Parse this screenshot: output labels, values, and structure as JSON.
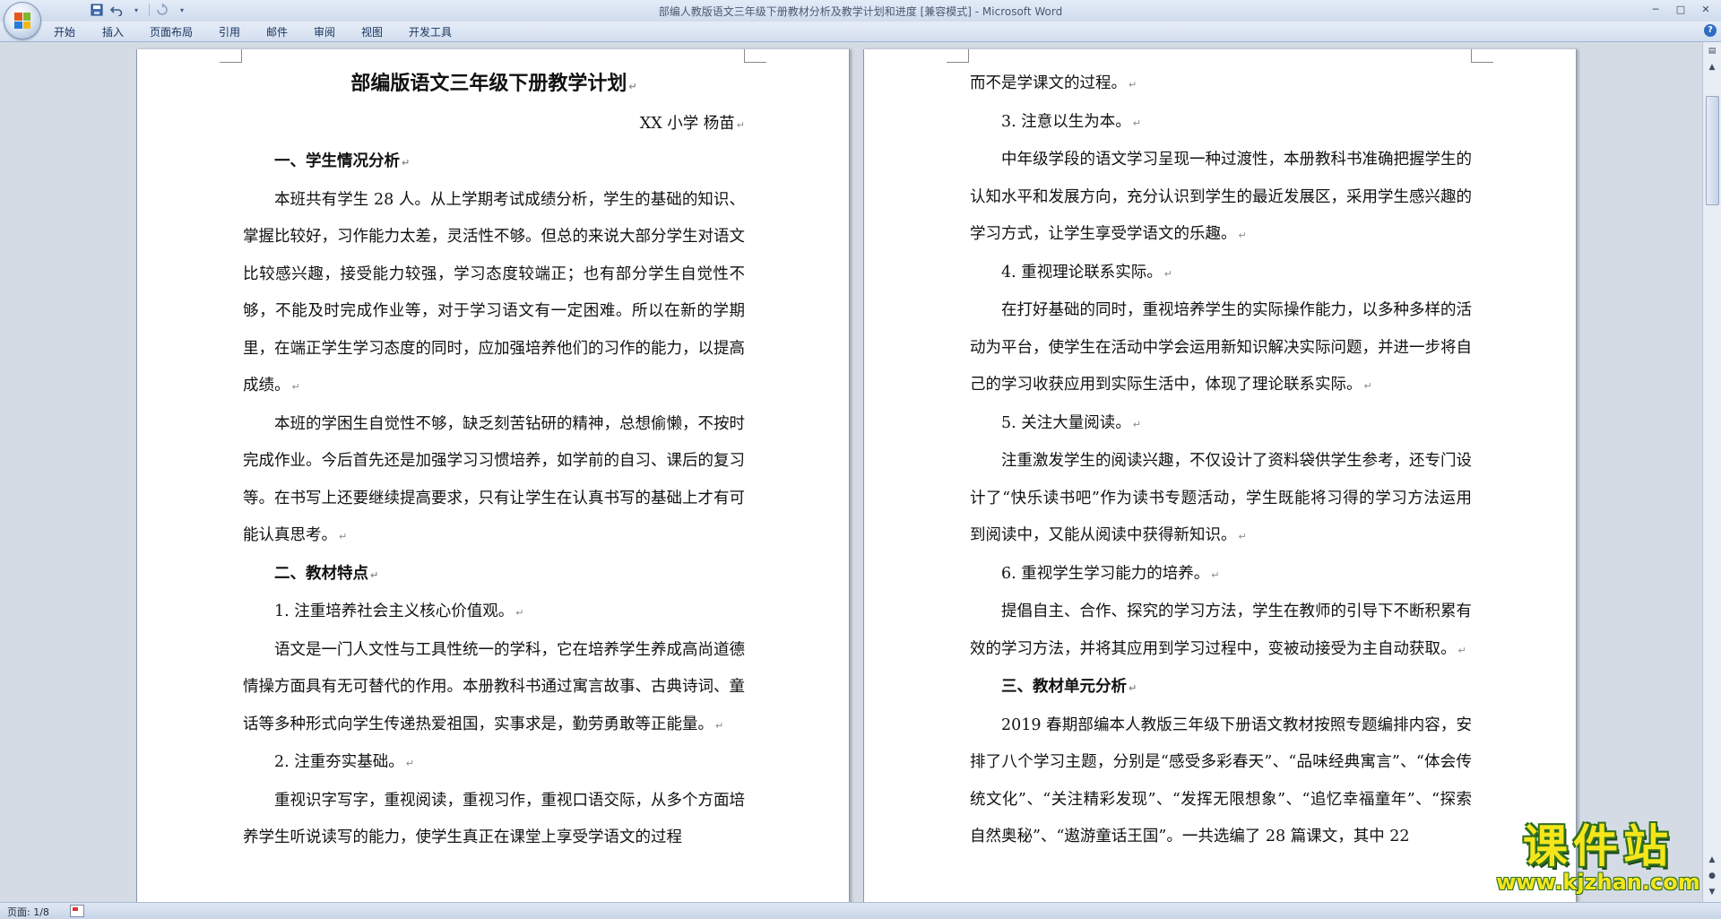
{
  "window": {
    "title": "部编人教版语文三年级下册教材分析及教学计划和进度 [兼容模式] - Microsoft Word",
    "controls": [
      "minimize-icon",
      "maximize-icon",
      "close-icon"
    ]
  },
  "quick_access": [
    "save-icon",
    "undo-icon",
    "redo-icon",
    "customize-icon"
  ],
  "ribbon": {
    "tabs": [
      "开始",
      "插入",
      "页面布局",
      "引用",
      "邮件",
      "审阅",
      "视图",
      "开发工具"
    ]
  },
  "document": {
    "left_page": {
      "title": "部编版语文三年级下册教学计划",
      "author": "XX 小学  杨苗",
      "h1": "一、学生情况分析",
      "p1": "本班共有学生 28 人。从上学期考试成绩分析，学生的基础的知识、掌握比较好，习作能力太差，灵活性不够。但总的来说大部分学生对语文比较感兴趣，接受能力较强，学习态度较端正；也有部分学生自觉性不够，不能及时完成作业等，对于学习语文有一定困难。所以在新的学期里，在端正学生学习态度的同时，应加强培养他们的习作的能力，以提高成绩。",
      "p2": "本班的学困生自觉性不够，缺乏刻苦钻研的精神，总想偷懒，不按时完成作业。今后首先还是加强学习习惯培养，如学前的自习、课后的复习等。在书写上还要继续提高要求，只有让学生在认真书写的基础上才有可能认真思考。",
      "h2": "二、教材特点",
      "s1": "1. 注重培养社会主义核心价值观。",
      "p3": "语文是一门人文性与工具性统一的学科，它在培养学生养成高尚道德情操方面具有无可替代的作用。本册教科书通过寓言故事、古典诗词、童话等多种形式向学生传递热爱祖国，实事求是，勤劳勇敢等正能量。",
      "s2": "2. 注重夯实基础。",
      "p4": "重视识字写字，重视阅读，重视习作，重视口语交际，从多个方面培养学生听说读写的能力，使学生真正在课堂上享受学语文的过程"
    },
    "right_page": {
      "c1": "而不是学课文的过程。",
      "s3": "3. 注意以生为本。",
      "p5": "中年级学段的语文学习呈现一种过渡性，本册教科书准确把握学生的认知水平和发展方向，充分认识到学生的最近发展区，采用学生感兴趣的学习方式，让学生享受学语文的乐趣。",
      "s4": "4. 重视理论联系实际。",
      "p6": "在打好基础的同时，重视培养学生的实际操作能力，以多种多样的活动为平台，使学生在活动中学会运用新知识解决实际问题，并进一步将自己的学习收获应用到实际生活中，体现了理论联系实际。",
      "s5": "5. 关注大量阅读。",
      "p7": "注重激发学生的阅读兴趣，不仅设计了资料袋供学生参考，还专门设计了“快乐读书吧”作为读书专题活动，学生既能将习得的学习方法运用到阅读中，又能从阅读中获得新知识。",
      "s6": "6. 重视学生学习能力的培养。",
      "p8": "提倡自主、合作、探究的学习方法，学生在教师的引导下不断积累有效的学习方法，并将其应用到学习过程中，变被动接受为主自动获取。",
      "h3": "三、教材单元分析",
      "p9": "2019 春期部编本人教版三年级下册语文教材按照专题编排内容，安排了八个学习主题，分别是“感受多彩春天”、“品味经典寓言”、“体会传统文化”、“关注精彩发现”、“发挥无限想象”、“追忆幸福童年”、“探索自然奥秘”、“遨游童话王国”。一共选编了 28 篇课文，其中 22"
    },
    "paragraph_mark": "↵"
  },
  "status": {
    "page_indicator": "页面: 1/8"
  },
  "watermark": {
    "main": "课件站",
    "url": "www.kjzhan.com"
  }
}
